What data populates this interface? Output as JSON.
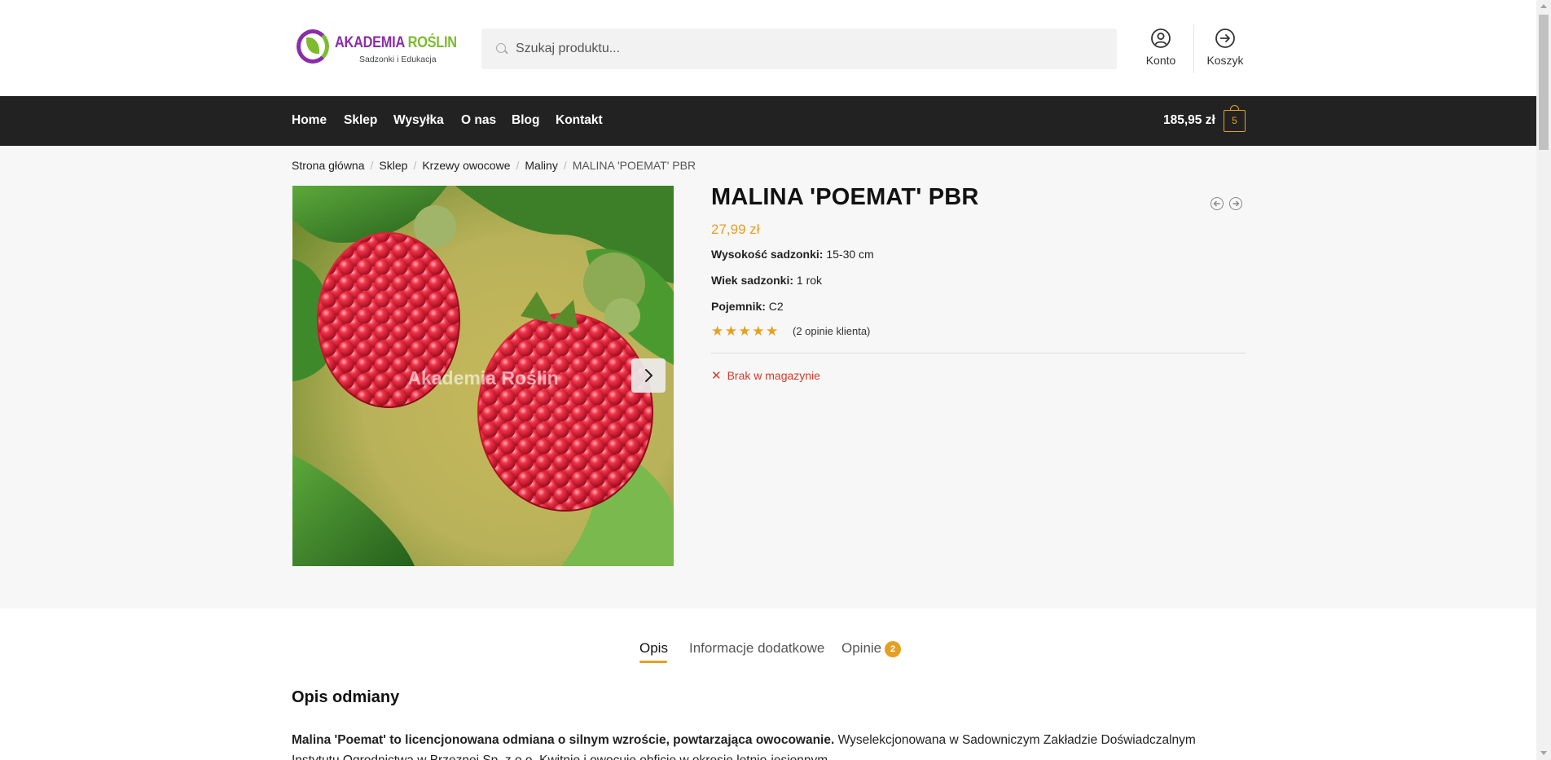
{
  "header": {
    "logo": {
      "title_main": "AKADEMIA ",
      "title_accent": "ROŚLIN",
      "subtitle": "Sadzonki i Edukacja"
    },
    "search": {
      "placeholder": "Szukaj produktu...",
      "value": ""
    },
    "account_label": "Konto",
    "cart_label": "Koszyk",
    "icons": {
      "search": "search-icon",
      "account": "user-circle-icon",
      "cart": "arrow-right-circle-icon"
    }
  },
  "nav": {
    "items": [
      {
        "label": "Home"
      },
      {
        "label": "Sklep"
      },
      {
        "label": "Wysyłka"
      },
      {
        "label": "O nas"
      },
      {
        "label": "Blog"
      },
      {
        "label": "Kontakt"
      }
    ],
    "cart_total": "185,95 zł",
    "cart_count": "5"
  },
  "breadcrumb": {
    "items": [
      "Strona główna",
      "Sklep",
      "Krzewy owocowe",
      "Maliny"
    ],
    "current": "MALINA 'POEMAT' PBR",
    "separator": "/"
  },
  "product": {
    "title": "MALINA 'POEMAT' PBR",
    "price": "27,99 zł",
    "attributes": [
      {
        "label": "Wysokość sadzonki:",
        "value": "15-30 cm"
      },
      {
        "label": "Wiek sadzonki:",
        "value": "1 rok"
      },
      {
        "label": "Pojemnik:",
        "value": "C2"
      }
    ],
    "rating": {
      "stars": 5,
      "max": 5,
      "glyphs": "★★★★★",
      "reviews_link": "(2 opinie klienta)"
    },
    "stock": {
      "icon": "close-icon",
      "text": "Brak w magazynie"
    },
    "image_watermark": "Akademia Roślin",
    "colors": {
      "accent": "#e5a023",
      "out_of_stock": "#d33b2a",
      "nav_bg": "#222222"
    }
  },
  "tabs": {
    "items": [
      {
        "label": "Opis"
      },
      {
        "label": "Informacje dodatkowe"
      },
      {
        "label": "Opinie"
      }
    ],
    "reviews_count": "2"
  },
  "description": {
    "heading": "Opis odmiany",
    "lead_bold": "Malina 'Poemat' to licencjonowana odmiana o silnym wzroście, powtarzająca owocowanie.",
    "text": " Wyselekcjonowana w Sadowniczym Zakładzie Doświadczalnym Instytutu Ogrodnictwa w Brzeznej Sp. z o.o. Kwitnie i owocuje obficie w okresie letnio-jesiennym."
  }
}
